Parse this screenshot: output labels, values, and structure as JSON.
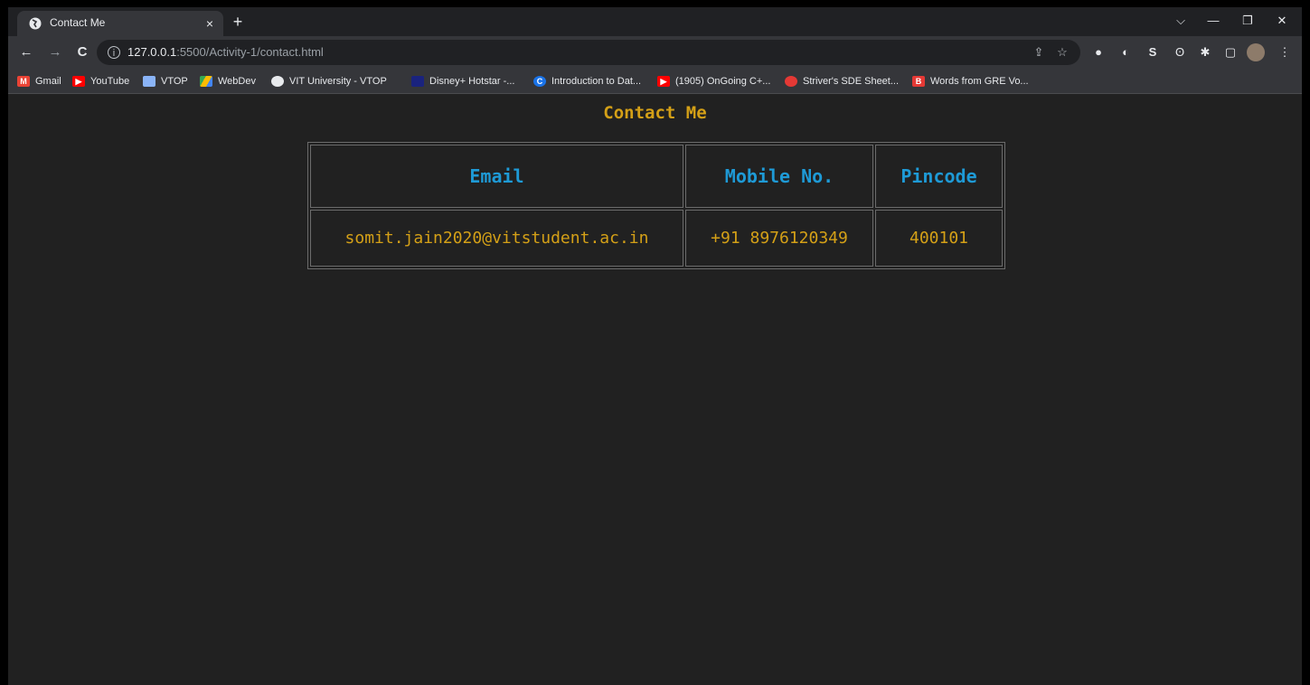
{
  "browser": {
    "tab_title": "Contact Me",
    "tab_close": "×",
    "new_tab": "+",
    "url_host": "127.0.0.1",
    "url_rest": ":5500/Activity-1/contact.html",
    "window_controls": {
      "dropdown": "⌵",
      "minimize": "—",
      "restore": "❐",
      "close": "✕"
    }
  },
  "bookmarks": [
    {
      "label": "Gmail",
      "icon": "gmail-icon",
      "color": "#ea4335"
    },
    {
      "label": "YouTube",
      "icon": "youtube-icon",
      "color": "#ff0000"
    },
    {
      "label": "VTOP",
      "icon": "vtop-icon",
      "color": "#8ab4f8"
    },
    {
      "label": "WebDev",
      "icon": "google-drive-icon",
      "color": "#34a853"
    },
    {
      "label": "VIT University - VTOP",
      "icon": "globe-icon",
      "color": "#e8eaed"
    },
    {
      "label": "Disney+ Hotstar -...",
      "icon": "hotstar-icon",
      "color": "#1a237e"
    },
    {
      "label": "Introduction to Dat...",
      "icon": "coursera-icon",
      "color": "#1a73e8"
    },
    {
      "label": "(1905) OnGoing C+...",
      "icon": "youtube-icon",
      "color": "#ff0000"
    },
    {
      "label": "Striver's SDE Sheet...",
      "icon": "tuf-icon",
      "color": "#e53935"
    },
    {
      "label": "Words from GRE Vo...",
      "icon": "b-icon",
      "color": "#e53935"
    }
  ],
  "page": {
    "title": "Contact Me",
    "table": {
      "headers": [
        "Email",
        "Mobile No.",
        "Pincode"
      ],
      "rows": [
        [
          "somit.jain2020@vitstudent.ac.in",
          "+91 8976120349",
          "400101"
        ]
      ]
    }
  },
  "colors": {
    "page_background": "#212121",
    "title_color": "#d4a017",
    "header_color": "#1e9ad6",
    "cell_color": "#d4a017"
  }
}
